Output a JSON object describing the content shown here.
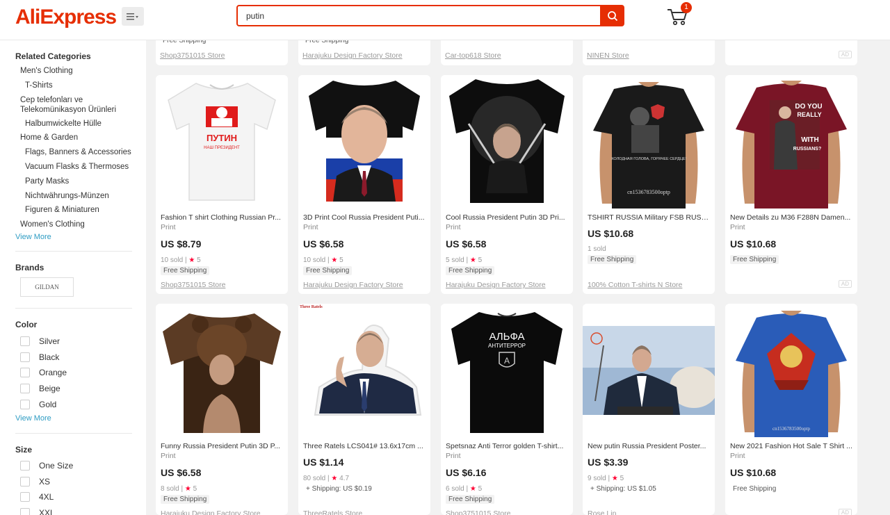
{
  "header": {
    "logo": "AliExpress",
    "search_value": "putin",
    "cart_count": "1"
  },
  "sidebar": {
    "related_title": "Related Categories",
    "categories": [
      {
        "label": "Men's Clothing",
        "level": 1
      },
      {
        "label": "T-Shirts",
        "level": 2
      },
      {
        "label": "Cep telefonları ve Telekomünikasyon Ürünleri",
        "level": 1
      },
      {
        "label": "Halbumwickelte Hülle",
        "level": 2
      },
      {
        "label": "Home & Garden",
        "level": 1
      },
      {
        "label": "Flags, Banners & Accessories",
        "level": 2
      },
      {
        "label": "Vacuum Flasks & Thermoses",
        "level": 2
      },
      {
        "label": "Party Masks",
        "level": 2
      },
      {
        "label": "Nichtwährungs-Münzen",
        "level": 2
      },
      {
        "label": "Figuren & Miniaturen",
        "level": 2
      },
      {
        "label": "Women's Clothing",
        "level": 1
      }
    ],
    "view_more": "View More",
    "brands_title": "Brands",
    "brand": "GILDAN",
    "color_title": "Color",
    "colors": [
      "Silver",
      "Black",
      "Orange",
      "Beige",
      "Gold"
    ],
    "size_title": "Size",
    "sizes": [
      "One Size",
      "XS",
      "4XL",
      "XXL"
    ]
  },
  "top_row": [
    {
      "ship": "Free Shipping",
      "store": "Shop3751015 Store"
    },
    {
      "ship": "Free Shipping",
      "store": "Harajuku Design Factory Store"
    },
    {
      "ship": "",
      "store": "Car-top618 Store"
    },
    {
      "ship": "",
      "store": "NINEN Store"
    },
    {
      "ship": "",
      "store": "",
      "ad": "AD"
    }
  ],
  "products": [
    {
      "title": "Fashion T shirt Clothing Russian Pr...",
      "print": "Print",
      "price": "US $8.79",
      "sold": "10 sold",
      "rating": "5",
      "ship": "Free Shipping",
      "store": "Shop3751015 Store",
      "ad": ""
    },
    {
      "title": "3D Print Cool Russia President Puti...",
      "print": "Print",
      "price": "US $6.58",
      "sold": "10 sold",
      "rating": "5",
      "ship": "Free Shipping",
      "store": "Harajuku Design Factory Store",
      "ad": ""
    },
    {
      "title": "Cool Russia President Putin 3D Pri...",
      "print": "Print",
      "price": "US $6.58",
      "sold": "5 sold",
      "rating": "5",
      "ship": "Free Shipping",
      "store": "Harajuku Design Factory Store",
      "ad": ""
    },
    {
      "title": "TSHIRT RUSSIA Military FSB RUSSI...",
      "print": "",
      "price": "US $10.68",
      "sold": "1 sold",
      "rating": "",
      "ship": "Free Shipping",
      "store": "100% Cotton T-shirts N Store",
      "ad": ""
    },
    {
      "title": "New Details zu M36 F288N Damen...",
      "print": "Print",
      "price": "US $10.68",
      "sold": "",
      "rating": "",
      "ship": "Free Shipping",
      "store": "",
      "ad": "AD"
    },
    {
      "title": "Funny Russia President Putin 3D P...",
      "print": "Print",
      "price": "US $6.58",
      "sold": "8 sold",
      "rating": "5",
      "ship": "Free Shipping",
      "store": "Harajuku Design Factory Store",
      "ad": ""
    },
    {
      "title": "Three Ratels LCS041# 13.6x17cm ...",
      "print": "",
      "price": "US $1.14",
      "sold": "80 sold",
      "rating": "4.7",
      "ship": "+ Shipping: US $0.19",
      "store": "ThreeRatels Store",
      "ad": ""
    },
    {
      "title": "Spetsnaz Anti Terror golden T-shirt...",
      "print": "Print",
      "price": "US $6.16",
      "sold": "6 sold",
      "rating": "5",
      "ship": "Free Shipping",
      "store": "Shop3751015 Store",
      "ad": ""
    },
    {
      "title": "New putin Russia President Poster...",
      "print": "",
      "price": "US $3.39",
      "sold": "9 sold",
      "rating": "5",
      "ship": "+ Shipping: US $1.05",
      "store": "Rose Lin",
      "ad": ""
    },
    {
      "title": "New 2021 Fashion Hot Sale T Shirt ...",
      "print": "Print",
      "price": "US $10.68",
      "sold": "",
      "rating": "",
      "ship": "Free Shipping",
      "store": "",
      "ad": "AD"
    }
  ],
  "image_text": {
    "putin_ru": "ПУТИН",
    "nash": "НАШ ПРЕЗИДЕНТ",
    "alfa": "АЛЬФА",
    "antiterror": "АНТИТЕРРОР",
    "three_ratels": "Three Ratels",
    "do_you": "DO YOU",
    "really": "REALLY",
    "with": "WITH",
    "russians": "RUSSIANS?",
    "fsb_caption": "ХОЛОДНАЯ ГОЛОВА, ГОРЯЧЕЕ СЕРДЦЕ!",
    "watermark": "cn1536783500optp"
  },
  "colors": {
    "brand": "#e62e04",
    "link": "#2e9cc3",
    "star": "#ff0033"
  }
}
